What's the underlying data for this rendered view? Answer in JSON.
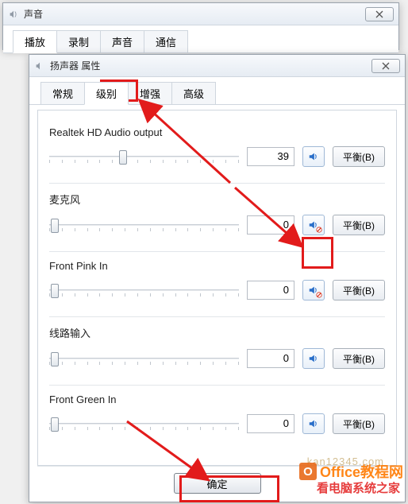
{
  "back_window": {
    "title": "声音",
    "tabs": [
      "播放",
      "录制",
      "声音",
      "通信"
    ],
    "active_tab": 0
  },
  "front_window": {
    "title": "扬声器 属性",
    "tabs": [
      "常规",
      "级别",
      "增强",
      "高级"
    ],
    "active_tab": 1,
    "ok_label": "确定",
    "groups": [
      {
        "label": "Realtek HD Audio output",
        "value": "39",
        "slider_pct": 39,
        "muted": false,
        "balance": "平衡(B)"
      },
      {
        "label": "麦克风",
        "value": "0",
        "slider_pct": 3,
        "muted": true,
        "balance": "平衡(B)"
      },
      {
        "label": "Front Pink In",
        "value": "0",
        "slider_pct": 3,
        "muted": true,
        "balance": "平衡(B)"
      },
      {
        "label": "线路输入",
        "value": "0",
        "slider_pct": 3,
        "muted": false,
        "balance": "平衡(B)"
      },
      {
        "label": "Front Green In",
        "value": "0",
        "slider_pct": 3,
        "muted": false,
        "balance": "平衡(B)"
      }
    ]
  },
  "watermarks": {
    "office": "Office教程网",
    "url": "kan12345.com",
    "site": "看电脑系统之家"
  }
}
